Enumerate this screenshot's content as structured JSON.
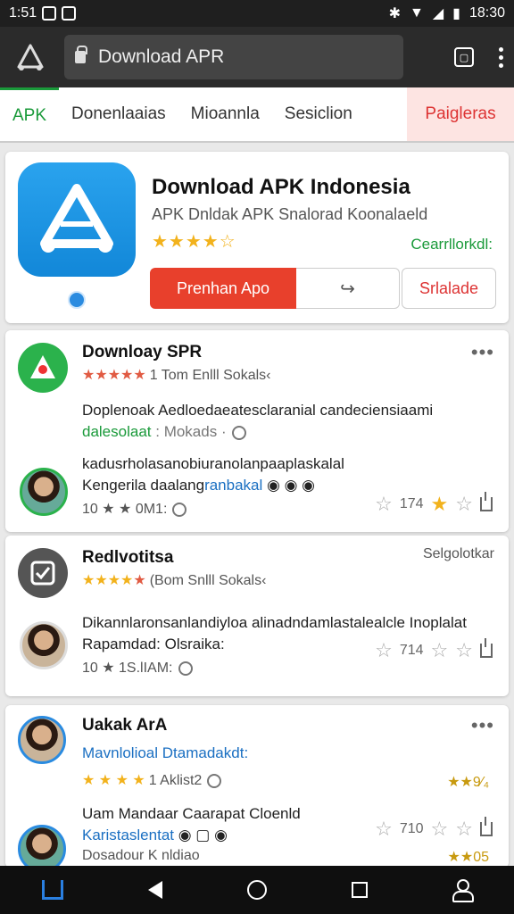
{
  "status": {
    "time": "1:51",
    "clock_right": "18:30"
  },
  "browser": {
    "url_text": "Download APR"
  },
  "tabs": [
    {
      "label": "APK"
    },
    {
      "label": "Donenlaaias"
    },
    {
      "label": "Mioannla"
    },
    {
      "label": "Sesiclion"
    },
    {
      "label": "Paigleras"
    }
  ],
  "hero": {
    "title": "Download APK Indonesia",
    "subtitle": "APK Dnldak APK Snalorad Koonalaeld",
    "stars": "★★★★☆",
    "link": "Cearrllorkdl:",
    "primary_button": "Prenhan Apo",
    "share_glyph": "↪",
    "secondary_button": "Srlalade"
  },
  "items": [
    {
      "title": "Downloay SPR",
      "rating_text": "1 Tom Enlll Sokals‹",
      "desc": "Doplenoak Aedloedaeatesclaranial candeciensiaami",
      "desc2_green": "dalesolaat",
      "desc2_gray": ": Mokads ·",
      "review_line1": "kadusrholasanobiuranolanpaaplaskalal",
      "review_line2_a": "Kengerila daalang",
      "review_line2_b": "ranbakal",
      "review_meta": "10 ★ ★ 0M1:",
      "score": "174",
      "more": "•••"
    },
    {
      "title": "Redlvotitsa",
      "rating_text": "(Bom Snlll Sokals‹",
      "right_label": "Selgolotkar",
      "review_line1": "Dikannlaronsanlandiyloa alinadndamlastalealcle Inoplalat",
      "review_line2": "Rapamdad: Olsraika:",
      "review_meta": "10 ★ 1S.lIAM:",
      "score": "714"
    },
    {
      "title": "Uakak ArA",
      "line_blue": "Mavnlolioal",
      "line_blue2": "Dtamadakdt:",
      "stars_text": "1 Aklist2",
      "right_stars": "★★9⁄₄",
      "review_line1": "Uam Mandaar Caarapat Cloenld",
      "review_line2_blue": "Karistaslentat",
      "review_meta": "Dosadour K nldiao",
      "score": "710",
      "right_small": "★★05",
      "more": "•••"
    }
  ]
}
